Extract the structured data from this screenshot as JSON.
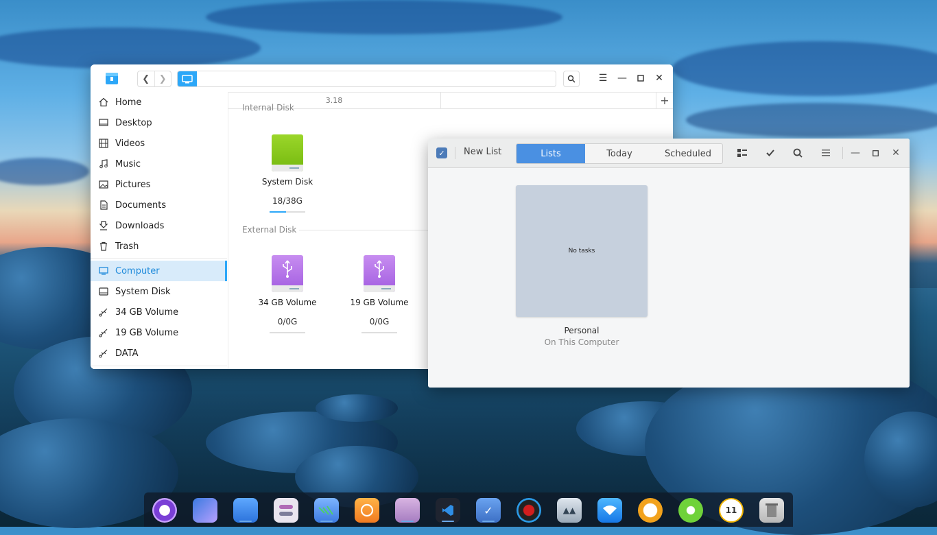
{
  "file_manager": {
    "address_value": "",
    "tab_label": "3.18",
    "sidebar": [
      {
        "label": "Home",
        "icon": "home-icon"
      },
      {
        "label": "Desktop",
        "icon": "desktop-icon"
      },
      {
        "label": "Videos",
        "icon": "videos-icon"
      },
      {
        "label": "Music",
        "icon": "music-icon"
      },
      {
        "label": "Pictures",
        "icon": "pictures-icon"
      },
      {
        "label": "Documents",
        "icon": "documents-icon"
      },
      {
        "label": "Downloads",
        "icon": "downloads-icon"
      },
      {
        "label": "Trash",
        "icon": "trash-icon"
      },
      {
        "label": "Computer",
        "icon": "computer-icon",
        "active": true
      },
      {
        "label": "System Disk",
        "icon": "disk-icon"
      },
      {
        "label": "34 GB Volume",
        "icon": "usb-icon"
      },
      {
        "label": "19 GB Volume",
        "icon": "usb-icon"
      },
      {
        "label": "DATA",
        "icon": "usb-icon"
      }
    ],
    "groups": {
      "internal": "Internal Disk",
      "external": "External Disk"
    },
    "disks": [
      {
        "name": "System Disk",
        "capacity": "18/38G",
        "used_fraction": 0.47,
        "color": "#8cc920"
      },
      {
        "name": "34 GB Volume",
        "capacity": "0/0G",
        "used_fraction": 0,
        "color": "#b577ea"
      },
      {
        "name": "19 GB Volume",
        "capacity": "0/0G",
        "used_fraction": 0,
        "color": "#b577ea"
      }
    ]
  },
  "tasks": {
    "new_list": "New List",
    "tabs": [
      "Lists",
      "Today",
      "Scheduled"
    ],
    "active_tab": "Lists",
    "card": {
      "empty_text": "No tasks",
      "title": "Personal",
      "subtitle": "On This Computer"
    }
  },
  "dock_icons": [
    "launcher-icon",
    "multitasking-icon",
    "screen-icon",
    "control-center-icon",
    "file-manager-icon",
    "firefox-icon",
    "deepin-file-manager-icon",
    "vscode-icon",
    "tasks-icon",
    "monitor-icon",
    "network-manager-icon",
    "wifi-icon",
    "chat-icon",
    "wechat-icon",
    "clock-icon",
    "trash-icon"
  ],
  "accent": "#2ca7f8"
}
